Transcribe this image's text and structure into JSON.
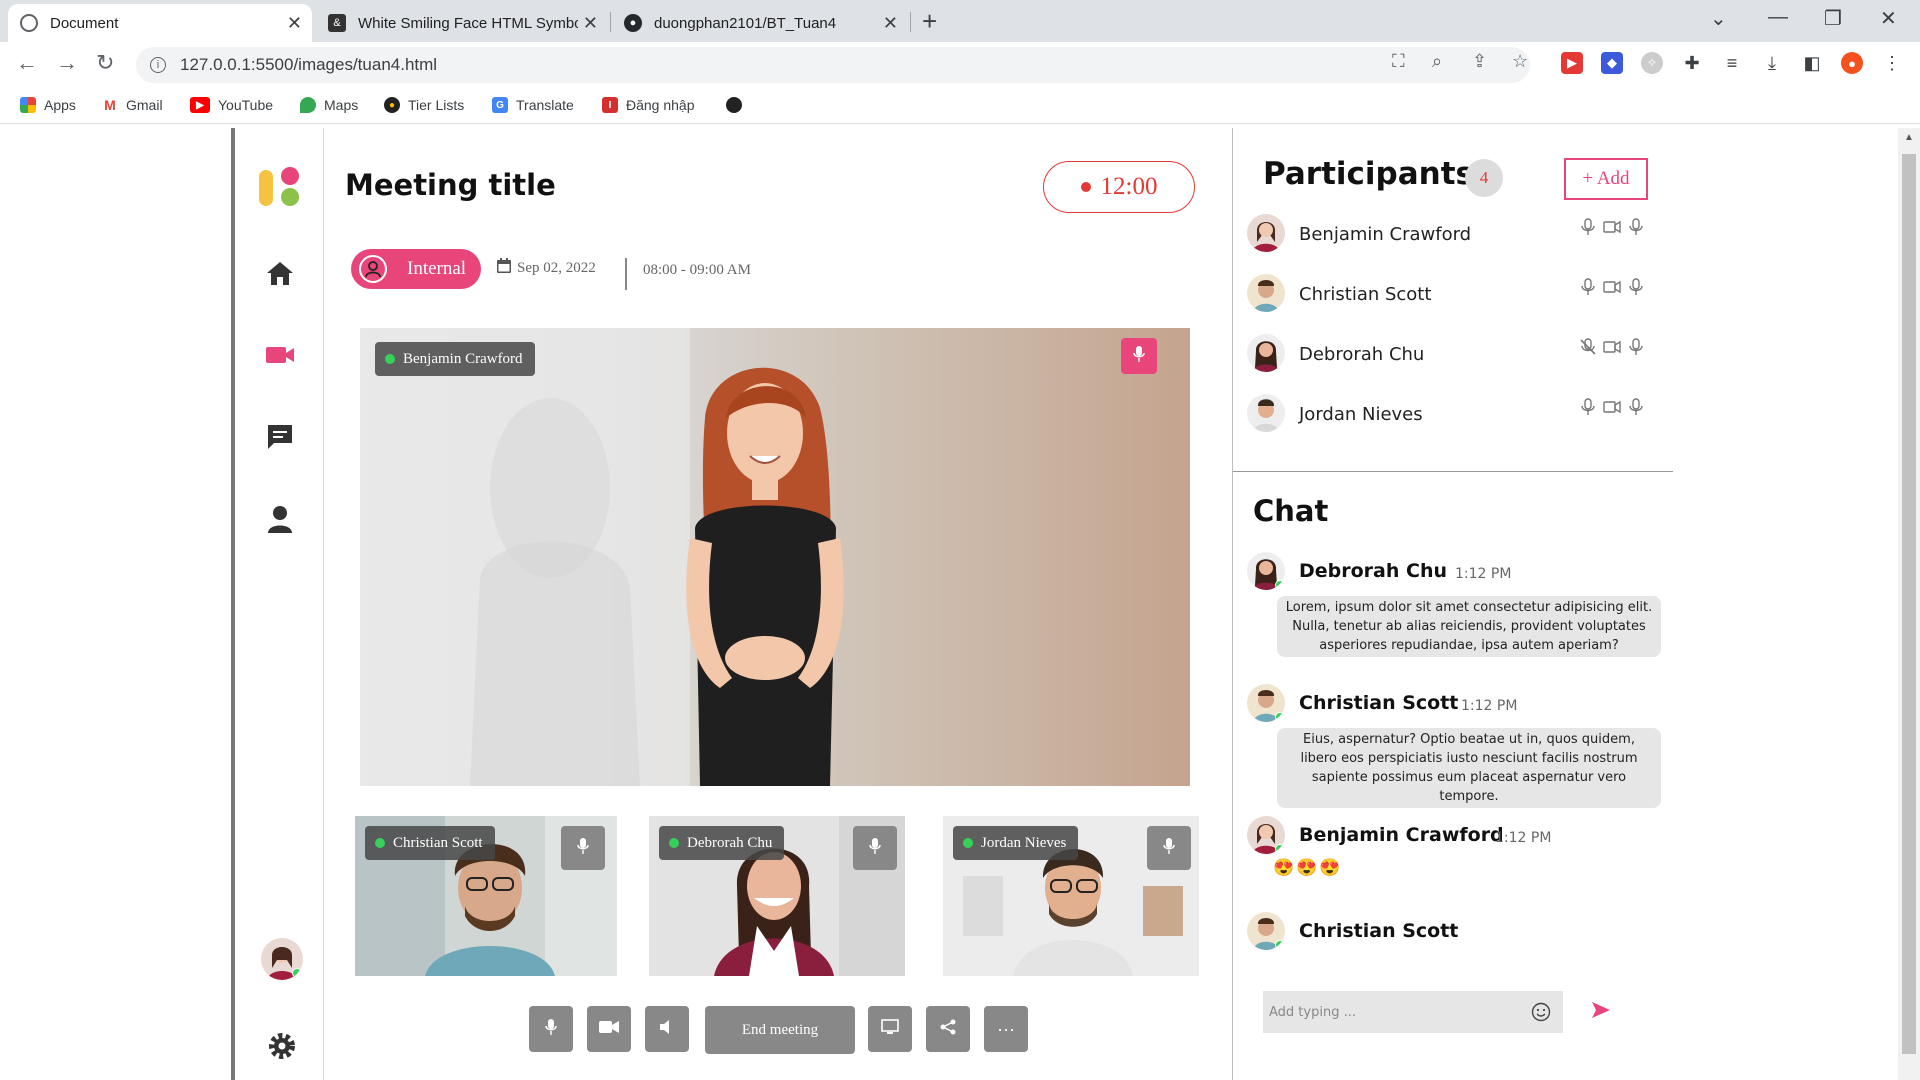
{
  "browser": {
    "tabs": [
      {
        "title": "Document"
      },
      {
        "title": "White Smiling Face HTML Symbo"
      },
      {
        "title": "duongphan2101/BT_Tuan4"
      }
    ],
    "url": "127.0.0.1:5500/images/tuan4.html",
    "bookmarks": [
      {
        "label": "Apps"
      },
      {
        "label": "Gmail"
      },
      {
        "label": "YouTube"
      },
      {
        "label": "Maps"
      },
      {
        "label": "Tier Lists"
      },
      {
        "label": "Translate"
      },
      {
        "label": "Đăng nhập"
      }
    ]
  },
  "meeting": {
    "title": "Meeting title",
    "timer": "12:00",
    "tag": "Internal",
    "date": "Sep 02, 2022",
    "time_range": "08:00 - 09:00 AM",
    "main_speaker": "Benjamin Crawford",
    "thumbnails": [
      {
        "name": "Christian Scott"
      },
      {
        "name": "Debrorah Chu"
      },
      {
        "name": "Jordan Nieves"
      }
    ],
    "end_label": "End meeting"
  },
  "participants": {
    "title": "Participants",
    "count": "4",
    "add_label": "+ Add",
    "list": [
      {
        "name": "Benjamin Crawford",
        "mic_muted": false
      },
      {
        "name": "Christian Scott",
        "mic_muted": false
      },
      {
        "name": "Debrorah Chu",
        "mic_muted": true
      },
      {
        "name": "Jordan Nieves",
        "mic_muted": false
      }
    ]
  },
  "chat": {
    "title": "Chat",
    "messages": [
      {
        "author": "Debrorah Chu",
        "time": "1:12 PM",
        "text": "Lorem, ipsum dolor sit amet consectetur adipisicing elit. Nulla, tenetur ab alias reiciendis, provident voluptates asperiores repudiandae, ipsa autem aperiam?"
      },
      {
        "author": "Christian Scott",
        "time": "1:12 PM",
        "text": "Eius, aspernatur? Optio beatae ut in, quos quidem, libero eos perspiciatis iusto nesciunt facilis nostrum sapiente possimus eum placeat aspernatur vero tempore."
      },
      {
        "author": "Benjamin Crawford",
        "time": "1:12 PM",
        "text": "😍😍😍"
      },
      {
        "author": "Christian Scott"
      }
    ],
    "input_placeholder": "Add typing ..."
  },
  "colors": {
    "accent": "#e8457b",
    "timer": "#e53935",
    "online": "#36d158",
    "control": "#888888"
  }
}
